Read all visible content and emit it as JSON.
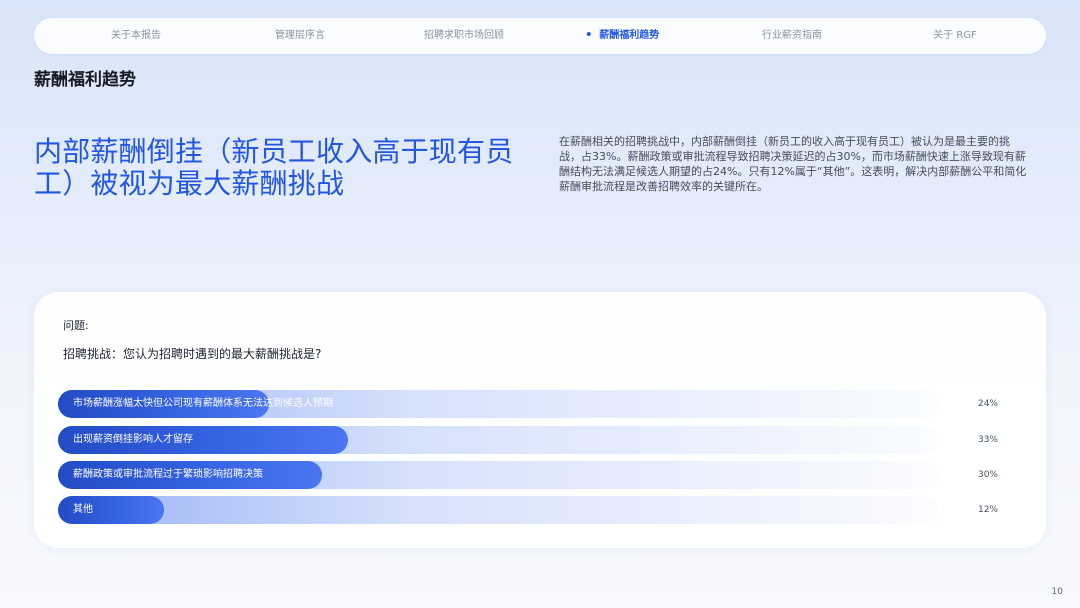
{
  "nav": {
    "items": [
      {
        "label": "关于本报告",
        "active": false
      },
      {
        "label": "管理层序言",
        "active": false
      },
      {
        "label": "招聘求职市场回顾",
        "active": false
      },
      {
        "label": "薪酬福利趋势",
        "active": true
      },
      {
        "label": "行业薪资指南",
        "active": false
      },
      {
        "label": "关于 RGF",
        "active": false
      }
    ]
  },
  "section": {
    "title": "薪酬福利趋势"
  },
  "headline": "内部薪酬倒挂（新员工收入高于现有员工）被视为最大薪酬挑战",
  "summary": "在薪酬相关的招聘挑战中，内部薪酬倒挂（新员工的收入高于现有员工）被认为是最主要的挑战，占33%。薪酬政策或审批流程导致招聘决策延迟的占30%，而市场薪酬快速上涨导致现有薪酬结构无法满足候选人期望的占24%。只有12%属于“其他”。这表明，解决内部薪酬公平和简化薪酬审批流程是改善招聘效率的关键所在。",
  "survey": {
    "question_label": "问题:",
    "question": "招聘挑战：您认为招聘时遇到的最大薪酬挑战是?",
    "options": [
      {
        "label": "市场薪酬涨幅太快但公司现有薪酬体系无法达到候选人预期",
        "value": 24,
        "display": "24%"
      },
      {
        "label": "出现薪资倒挂影响人才留存",
        "value": 33,
        "display": "33%"
      },
      {
        "label": "薪酬政策或审批流程过于繁琐影响招聘决策",
        "value": 30,
        "display": "30%"
      },
      {
        "label": "其他",
        "value": 12,
        "display": "12%"
      }
    ]
  },
  "page_number": "10",
  "colors": {
    "primary": "#2357e2",
    "bar_dark": "#234bc4"
  }
}
